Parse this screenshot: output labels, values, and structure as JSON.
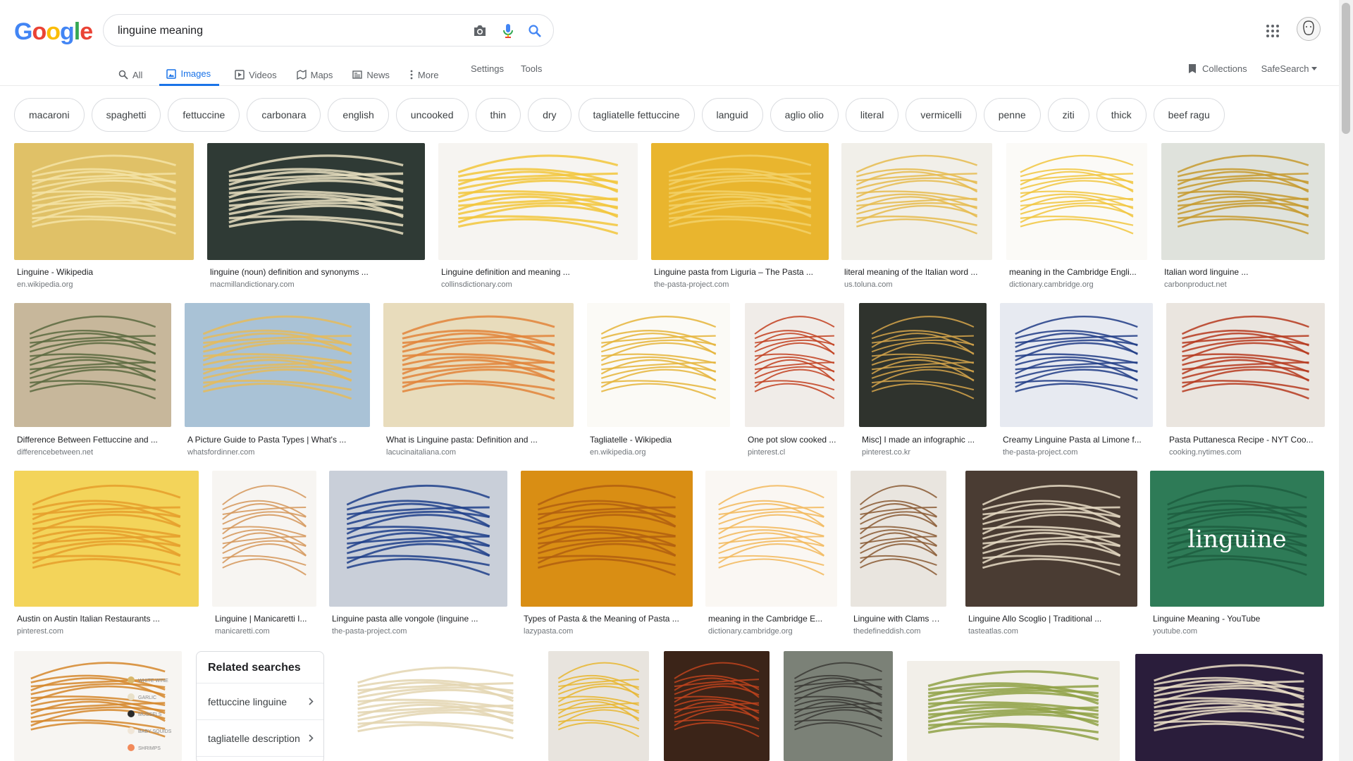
{
  "logo": {
    "text": "Google",
    "letters": [
      "G",
      "o",
      "o",
      "g",
      "l",
      "e"
    ]
  },
  "search": {
    "query": "linguine meaning",
    "placeholder": ""
  },
  "tabs": [
    {
      "label": "All",
      "icon": "search-icon"
    },
    {
      "label": "Images",
      "icon": "image-icon",
      "active": true
    },
    {
      "label": "Videos",
      "icon": "video-icon"
    },
    {
      "label": "Maps",
      "icon": "map-icon"
    },
    {
      "label": "News",
      "icon": "news-icon"
    },
    {
      "label": "More",
      "icon": "more-vert-icon"
    }
  ],
  "tools": {
    "settings": "Settings",
    "tools": "Tools",
    "collections": "Collections",
    "safesearch": "SafeSearch"
  },
  "chips": [
    "macaroni",
    "spaghetti",
    "fettuccine",
    "carbonara",
    "english",
    "uncooked",
    "thin",
    "dry",
    "tagliatelle fettuccine",
    "languid",
    "aglio olio",
    "literal",
    "vermicelli",
    "penne",
    "ziti",
    "thick",
    "beef ragu"
  ],
  "rows": [
    [
      {
        "title": "Linguine - Wikipedia",
        "source": "en.wikipedia.org",
        "palette": [
          "#e0c167",
          "#f3e3a6"
        ]
      },
      {
        "title": "linguine (noun) definition and synonyms ...",
        "source": "macmillandictionary.com",
        "palette": [
          "#2f3a35",
          "#e8dfc0"
        ]
      },
      {
        "title": "Linguine definition and meaning ...",
        "source": "collinsdictionary.com",
        "palette": [
          "#f6f4f1",
          "#f2c53b"
        ]
      },
      {
        "title": "Linguine pasta from Liguria – The Pasta ...",
        "source": "the-pasta-project.com",
        "palette": [
          "#e9b52e",
          "#f2d168"
        ]
      },
      {
        "title": "literal meaning of the Italian word ...",
        "source": "us.toluna.com",
        "palette": [
          "#f1efe9",
          "#e6bb4e"
        ]
      },
      {
        "title": "meaning in the Cambridge Engli...",
        "source": "dictionary.cambridge.org",
        "palette": [
          "#fbfaf7",
          "#f1c53f"
        ]
      },
      {
        "title": "Italian word linguine ...",
        "source": "carbonproduct.net",
        "palette": [
          "#dfe2dc",
          "#c79a2e"
        ]
      }
    ],
    [
      {
        "title": "Difference Between Fettuccine and ...",
        "source": "differencebetween.net",
        "palette": [
          "#c7b79b",
          "#5a6a40"
        ]
      },
      {
        "title": "A Picture Guide to Pasta Types | What's ...",
        "source": "whatsfordinner.com",
        "palette": [
          "#a9c2d6",
          "#e5bb5c"
        ]
      },
      {
        "title": "What is Linguine pasta: Definition and ...",
        "source": "lacucinaitaliana.com",
        "palette": [
          "#e8dcbc",
          "#e2843a"
        ]
      },
      {
        "title": "Tagliatelle - Wikipedia",
        "source": "en.wikipedia.org",
        "palette": [
          "#fbfaf6",
          "#e5b43a"
        ]
      },
      {
        "title": "One pot slow cooked ...",
        "source": "pinterest.cl",
        "palette": [
          "#f0ece8",
          "#c2401f"
        ]
      },
      {
        "title": "Misc] I made an infographic ...",
        "source": "pinterest.co.kr",
        "palette": [
          "#2f332d",
          "#d6a64b"
        ]
      },
      {
        "title": "Creamy Linguine Pasta al Limone f...",
        "source": "the-pasta-project.com",
        "palette": [
          "#e7eaf1",
          "#203c86"
        ]
      },
      {
        "title": "Pasta Puttanesca Recipe - NYT Coo...",
        "source": "cooking.nytimes.com",
        "palette": [
          "#eae5df",
          "#b63a1e"
        ]
      }
    ],
    [
      {
        "title": "Austin on Austin Italian Restaurants ...",
        "source": "pinterest.com",
        "palette": [
          "#f3d45a",
          "#e59e2b"
        ]
      },
      {
        "title": "Linguine | Manicaretti I...",
        "source": "manicaretti.com",
        "palette": [
          "#f7f5f2",
          "#d5965a"
        ]
      },
      {
        "title": "Linguine pasta alle vongole (linguine ...",
        "source": "the-pasta-project.com",
        "palette": [
          "#c9cfd9",
          "#1f3f8a"
        ]
      },
      {
        "title": "Types of Pasta & the Meaning of Pasta ...",
        "source": "lazypasta.com",
        "palette": [
          "#d98e14",
          "#b05f10"
        ]
      },
      {
        "title": "meaning in the Cambridge E...",
        "source": "dictionary.cambridge.org",
        "palette": [
          "#faf7f3",
          "#f2b95b"
        ]
      },
      {
        "title": "Linguine with Clams – ...",
        "source": "thedefineddish.com",
        "palette": [
          "#e9e5df",
          "#8a5a34"
        ]
      },
      {
        "title": "Linguine Allo Scoglio | Traditional ...",
        "source": "tasteatlas.com",
        "palette": [
          "#4a3c33",
          "#e7dcc6"
        ]
      },
      {
        "title": "Linguine Meaning - YouTube",
        "source": "youtube.com",
        "palette": [
          "#2e7b57",
          "#1d5e40"
        ],
        "overlay": "linguine"
      }
    ]
  ],
  "bottom_row": [
    {
      "palette": [
        "#f7f5f2",
        "#d5862a"
      ],
      "legend": [
        "WHITE WINE",
        "GARLIC",
        "MUSSELS",
        "BABY SQUIDS",
        "SHRIMPS"
      ]
    },
    {
      "palette": [
        "#ffffff",
        "#e3d5b0"
      ]
    },
    {
      "palette": [
        "#e8e4de",
        "#e7b62f"
      ]
    },
    {
      "palette": [
        "#3b2418",
        "#c0431d"
      ]
    },
    {
      "palette": [
        "#7b8177",
        "#3b3a35"
      ]
    },
    {
      "palette": [
        "#f2efe9",
        "#8fa145"
      ]
    },
    {
      "palette": [
        "#2a1d3b",
        "#ece1c8"
      ]
    }
  ],
  "related": {
    "title": "Related searches",
    "items": [
      "fettuccine linguine",
      "tagliatelle description"
    ]
  }
}
